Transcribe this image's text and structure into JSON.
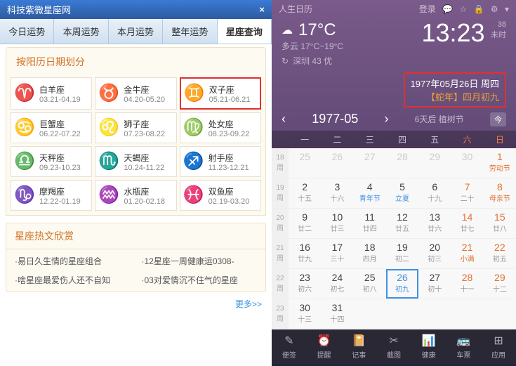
{
  "left": {
    "title": "科技紫微星座网",
    "tabs": [
      "今日运势",
      "本周运势",
      "本月运势",
      "整年运势",
      "星座查询"
    ],
    "active_tab": 4,
    "section_title": "按阳历日期划分",
    "zodiac": [
      {
        "name": "白羊座",
        "date": "03.21-04.19",
        "glyph": "♈"
      },
      {
        "name": "金牛座",
        "date": "04.20-05.20",
        "glyph": "♉"
      },
      {
        "name": "双子座",
        "date": "05.21-06.21",
        "glyph": "♊",
        "hl": true
      },
      {
        "name": "巨蟹座",
        "date": "06.22-07.22",
        "glyph": "♋"
      },
      {
        "name": "狮子座",
        "date": "07.23-08.22",
        "glyph": "♌"
      },
      {
        "name": "处女座",
        "date": "08.23-09.22",
        "glyph": "♍"
      },
      {
        "name": "天秤座",
        "date": "09.23-10.23",
        "glyph": "♎"
      },
      {
        "name": "天蝎座",
        "date": "10.24-11.22",
        "glyph": "♏"
      },
      {
        "name": "射手座",
        "date": "11.23-12.21",
        "glyph": "♐"
      },
      {
        "name": "摩羯座",
        "date": "12.22-01.19",
        "glyph": "♑"
      },
      {
        "name": "水瓶座",
        "date": "01.20-02.18",
        "glyph": "♒"
      },
      {
        "name": "双鱼座",
        "date": "02.19-03.20",
        "glyph": "♓"
      }
    ],
    "hot_title": "星座热文欣赏",
    "hot_items": [
      "·易日久生情的星座组合",
      "·12星座一周健康运0308-",
      "·啥星座最爱伤人还不自知",
      "·03对爱情沉不住气的星座"
    ],
    "more": "更多>>"
  },
  "right": {
    "app_name": "人生日历",
    "login": "登录",
    "temp": "17°C",
    "weather_desc": "多云 17°C~19°C",
    "time": "13:23",
    "time_side_top": "38",
    "time_side_bot": "未时",
    "date_line1": "1977年05月26日 周四",
    "date_line2": "【蛇年】四月初九",
    "location": "深圳 43 优",
    "refresh_icon": "↻",
    "month": "1977-05",
    "upcoming": "6天后 植树节",
    "today_btn": "今",
    "weekdays": [
      "一",
      "二",
      "三",
      "四",
      "五",
      "六",
      "日"
    ],
    "weeks": [
      {
        "wn": "18",
        "wl": "周",
        "days": [
          {
            "n": "25",
            "s": "",
            "o": true
          },
          {
            "n": "26",
            "s": "",
            "o": true
          },
          {
            "n": "27",
            "s": "",
            "o": true
          },
          {
            "n": "28",
            "s": "",
            "o": true
          },
          {
            "n": "29",
            "s": "",
            "o": true
          },
          {
            "n": "30",
            "s": "",
            "o": true
          },
          {
            "n": "1",
            "s": "劳动节",
            "h": true,
            "we": true
          }
        ]
      },
      {
        "wn": "19",
        "wl": "周",
        "days": [
          {
            "n": "2",
            "s": "十五"
          },
          {
            "n": "3",
            "s": "十六"
          },
          {
            "n": "4",
            "s": "青年节",
            "t": true
          },
          {
            "n": "5",
            "s": "立夏",
            "t": true
          },
          {
            "n": "6",
            "s": "十九"
          },
          {
            "n": "7",
            "s": "二十",
            "we": true
          },
          {
            "n": "8",
            "s": "母亲节",
            "h": true,
            "we": true
          }
        ]
      },
      {
        "wn": "20",
        "wl": "周",
        "days": [
          {
            "n": "9",
            "s": "廿二"
          },
          {
            "n": "10",
            "s": "廿三"
          },
          {
            "n": "11",
            "s": "廿四"
          },
          {
            "n": "12",
            "s": "廿五"
          },
          {
            "n": "13",
            "s": "廿六"
          },
          {
            "n": "14",
            "s": "廿七",
            "we": true
          },
          {
            "n": "15",
            "s": "廿八",
            "we": true
          }
        ]
      },
      {
        "wn": "21",
        "wl": "周",
        "days": [
          {
            "n": "16",
            "s": "廿九"
          },
          {
            "n": "17",
            "s": "三十"
          },
          {
            "n": "18",
            "s": "四月"
          },
          {
            "n": "19",
            "s": "初二"
          },
          {
            "n": "20",
            "s": "初三"
          },
          {
            "n": "21",
            "s": "小满",
            "h": true,
            "we": true
          },
          {
            "n": "22",
            "s": "初五",
            "we": true
          }
        ]
      },
      {
        "wn": "22",
        "wl": "周",
        "days": [
          {
            "n": "23",
            "s": "初六"
          },
          {
            "n": "24",
            "s": "初七"
          },
          {
            "n": "25",
            "s": "初八"
          },
          {
            "n": "26",
            "s": "初九",
            "sel": true
          },
          {
            "n": "27",
            "s": "初十"
          },
          {
            "n": "28",
            "s": "十一",
            "we": true
          },
          {
            "n": "29",
            "s": "十二",
            "we": true
          }
        ]
      },
      {
        "wn": "23",
        "wl": "周",
        "days": [
          {
            "n": "30",
            "s": "十三"
          },
          {
            "n": "31",
            "s": "十四"
          },
          {
            "n": "",
            "s": ""
          },
          {
            "n": "",
            "s": ""
          },
          {
            "n": "",
            "s": ""
          },
          {
            "n": "",
            "s": ""
          },
          {
            "n": "",
            "s": ""
          }
        ]
      }
    ],
    "bottom": [
      {
        "icon": "✎",
        "label": "便签"
      },
      {
        "icon": "⏰",
        "label": "提醒"
      },
      {
        "icon": "📔",
        "label": "记事"
      },
      {
        "icon": "✂",
        "label": "截图"
      },
      {
        "icon": "📊",
        "label": "健康"
      },
      {
        "icon": "🚌",
        "label": "车票"
      },
      {
        "icon": "⊞",
        "label": "应用"
      }
    ]
  }
}
